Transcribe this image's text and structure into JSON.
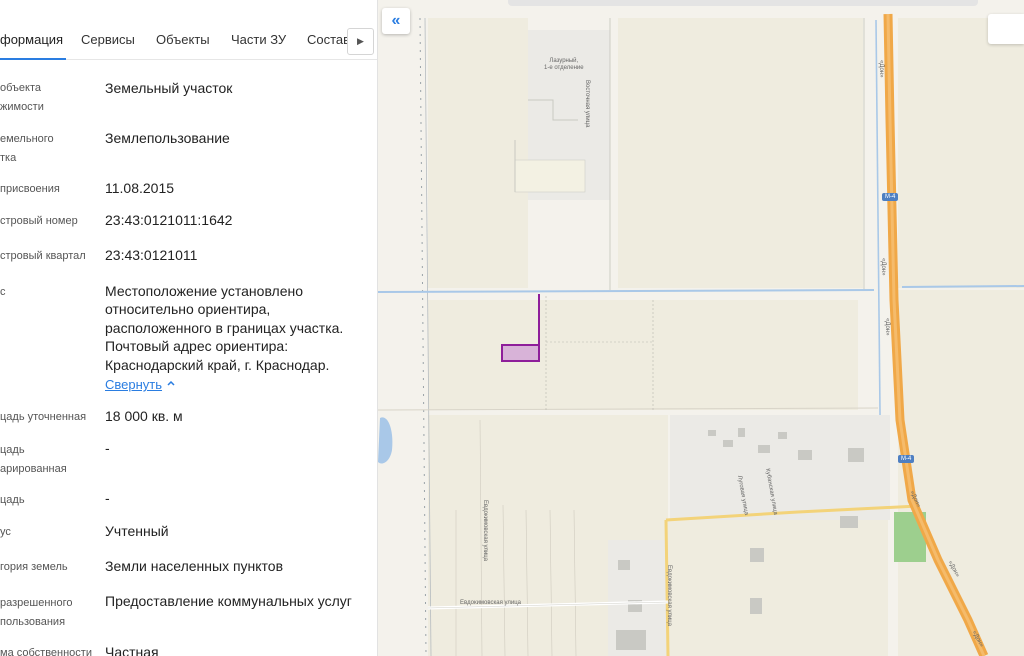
{
  "tabs": [
    {
      "label": "формация",
      "active": true
    },
    {
      "label": "Сервисы",
      "active": false
    },
    {
      "label": "Объекты",
      "active": false
    },
    {
      "label": "Части ЗУ",
      "active": false
    },
    {
      "label": "Состав",
      "active": false
    }
  ],
  "rows": [
    {
      "label": [
        "объекта",
        "жимости"
      ],
      "value": [
        "Земельный участок"
      ]
    },
    {
      "label": [
        "емельного",
        "тка"
      ],
      "value": [
        "Землепользование"
      ]
    },
    {
      "label": [
        "присвоения"
      ],
      "value": [
        "11.08.2015"
      ]
    },
    {
      "label": [
        "стровый номер"
      ],
      "value": [
        "23:43:0121011:1642"
      ]
    },
    {
      "label": [
        "стровый квартал"
      ],
      "value": [
        "23:43:0121011"
      ]
    },
    {
      "label": [
        "с"
      ],
      "value": [
        "Местоположение установлено",
        "относительно ориентира,",
        "расположенного в границах участка.",
        "Почтовый адрес ориентира:",
        "Краснодарский край, г. Краснодар."
      ]
    },
    {
      "label": [
        "цадь уточненная"
      ],
      "value": [
        "18 000 кв. м"
      ]
    },
    {
      "label": [
        "цадь",
        "арированная"
      ],
      "value": [
        "-"
      ]
    },
    {
      "label": [
        "цадь"
      ],
      "value": [
        "-"
      ]
    },
    {
      "label": [
        "ус"
      ],
      "value": [
        "Учтенный"
      ]
    },
    {
      "label": [
        "гория земель"
      ],
      "value": [
        "Земли населенных пунктов"
      ]
    },
    {
      "label": [
        "разрешенного",
        "пользования"
      ],
      "value": [
        "Предоставление коммунальных услуг"
      ]
    },
    {
      "label": [
        "ма собственности"
      ],
      "value": [
        "Частная"
      ]
    }
  ],
  "collapse_link": "Свернуть",
  "map": {
    "labels": {
      "settlement": [
        "Лазурный,",
        "1-е отделение"
      ],
      "street_east": "Восточная улица",
      "street_evdokimov_v1": "Евдокимовская улица",
      "street_evdokimov_v2": "Евдокимовская улица",
      "street_evdokimov_h": "Евдокимовская улица",
      "street_kuban": "Кубанская улица",
      "street_lugov": "Луговая улица",
      "hw_don": "«Дон»",
      "route": "М-4"
    },
    "colors": {
      "background": "#f4f2ec",
      "highway": "#f0a848",
      "parcel": "#8e1e9a",
      "water_line": "#a9c8e8",
      "road_yellow": "#f3d37a"
    }
  }
}
